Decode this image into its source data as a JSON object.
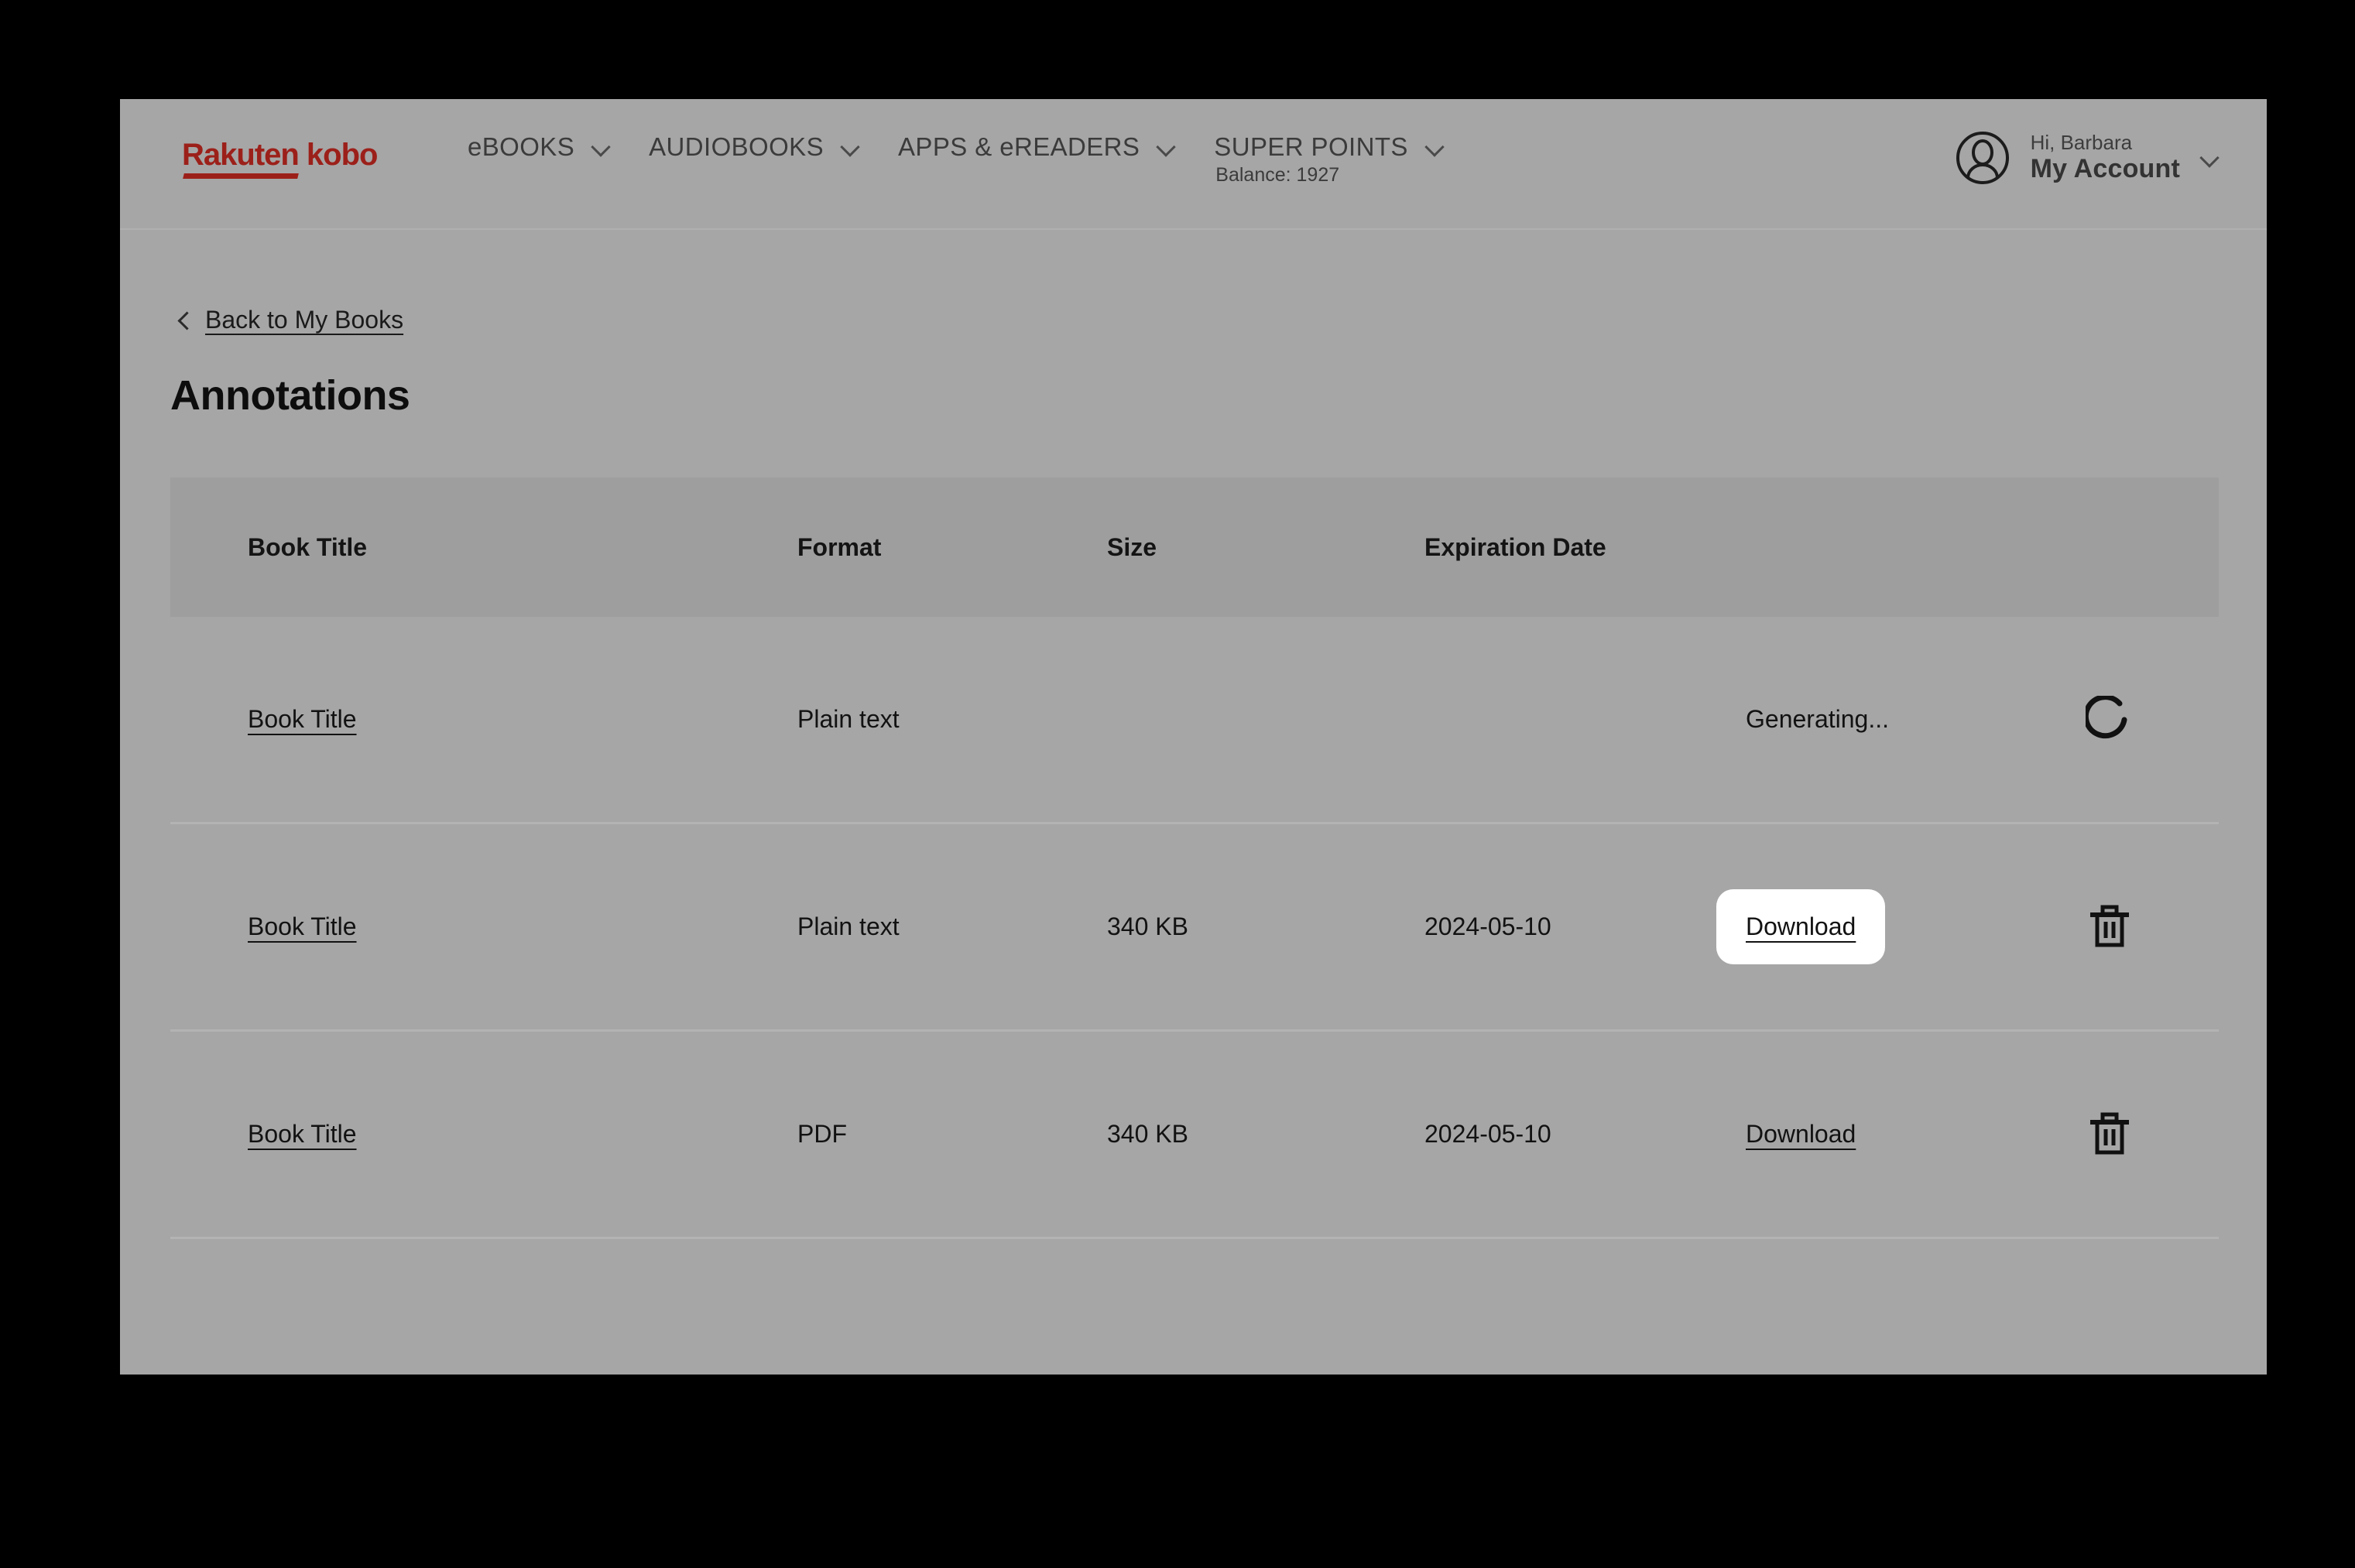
{
  "header": {
    "logo_text": "Rakuten kobo",
    "nav": [
      {
        "label": "eBOOKS",
        "sub": ""
      },
      {
        "label": "AUDIOBOOKS",
        "sub": ""
      },
      {
        "label": "APPS & eREADERS",
        "sub": ""
      },
      {
        "label": "SUPER POINTS",
        "sub": "Balance: 1927"
      }
    ],
    "account": {
      "greeting": "Hi, Barbara",
      "name": "My Account"
    }
  },
  "content": {
    "back_link": "Back to My Books",
    "page_title": "Annotations"
  },
  "table": {
    "columns": [
      "Book Title",
      "Format",
      "Size",
      "Expiration Date"
    ],
    "rows": [
      {
        "title": "Book Title",
        "format": "Plain text",
        "size": "",
        "expiration": "",
        "action": "Generating...",
        "action_type": "status",
        "has_delete": false,
        "focused": false
      },
      {
        "title": "Book Title",
        "format": "Plain text",
        "size": "340 KB",
        "expiration": "2024-05-10",
        "action": "Download",
        "action_type": "link",
        "has_delete": true,
        "focused": true
      },
      {
        "title": "Book Title",
        "format": "PDF",
        "size": "340 KB",
        "expiration": "2024-05-10",
        "action": "Download",
        "action_type": "link",
        "has_delete": true,
        "focused": false
      }
    ]
  },
  "colors": {
    "brand_red": "#9c201a",
    "page_bg": "#a6a6a6",
    "table_head_bg": "#9e9e9e",
    "divider": "#b3b3b3",
    "focus_bg": "#ffffff",
    "backdrop": "#000000"
  }
}
